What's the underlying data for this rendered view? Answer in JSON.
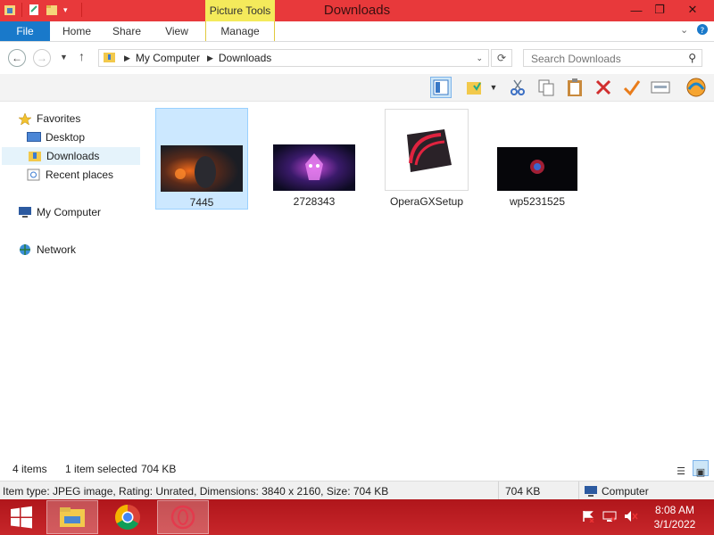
{
  "window": {
    "title": "Downloads",
    "context_tab": "Picture Tools",
    "controls": {
      "minimize": "—",
      "maximize": "❐",
      "close": "✕"
    }
  },
  "ribbon": {
    "file_tab": "File",
    "tabs": [
      "Home",
      "Share",
      "View",
      "Manage"
    ],
    "collapse_icon": "chevron-down",
    "help_icon": "help"
  },
  "address_bar": {
    "path": [
      "My Computer",
      "Downloads"
    ],
    "search_placeholder": "Search Downloads"
  },
  "nav_pane": {
    "favorites_label": "Favorites",
    "favorites": [
      "Desktop",
      "Downloads",
      "Recent places"
    ],
    "selected": "Downloads",
    "my_computer": "My Computer",
    "network": "Network"
  },
  "files": [
    {
      "name": "7445",
      "type": "image",
      "selected": true
    },
    {
      "name": "2728343",
      "type": "image",
      "selected": false
    },
    {
      "name": "OperaGXSetup",
      "type": "installer",
      "selected": false
    },
    {
      "name": "wp5231525",
      "type": "image",
      "selected": false
    }
  ],
  "status": {
    "item_count": "4 items",
    "selection": "1 item selected",
    "selection_size": "704 KB",
    "details": "Item type: JPEG image, Rating: Unrated, Dimensions: 3840 x 2160, Size: 704 KB",
    "size": "704 KB",
    "location": "Computer"
  },
  "taskbar": {
    "apps": [
      "file-explorer",
      "chrome",
      "opera-gx"
    ],
    "time": "8:08 AM",
    "date": "3/1/2022"
  },
  "colors": {
    "title_bar": "#e8393b",
    "file_tab": "#1979ca",
    "context_tab": "#f4ea5b",
    "selection": "#cce8ff",
    "taskbar": "#c7262a"
  }
}
